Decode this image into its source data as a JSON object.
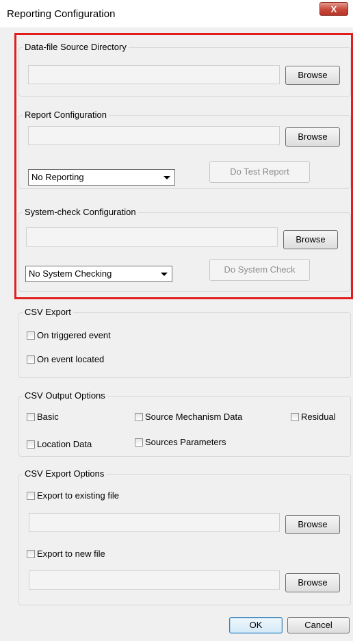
{
  "window": {
    "title": "Reporting Configuration",
    "close_glyph": "X"
  },
  "data_source": {
    "group_label": "Data-file Source Directory",
    "path": "",
    "browse_label": "Browse"
  },
  "report_config": {
    "group_label": "Report Configuration",
    "path": "",
    "browse_label": "Browse",
    "mode_value": "No Reporting",
    "test_label": "Do Test Report"
  },
  "system_check": {
    "group_label": "System-check Configuration",
    "path": "",
    "browse_label": "Browse",
    "mode_value": "No System Checking",
    "check_label": "Do System Check"
  },
  "csv_export": {
    "group_label": "CSV Export",
    "options": [
      {
        "label": "On triggered event",
        "checked": false
      },
      {
        "label": "On event located",
        "checked": false
      }
    ]
  },
  "csv_output": {
    "group_label": "CSV Output Options",
    "options": [
      {
        "label": "Basic",
        "checked": false
      },
      {
        "label": "Source Mechanism Data",
        "checked": false
      },
      {
        "label": "Residual",
        "checked": false
      },
      {
        "label": "Location Data",
        "checked": false
      },
      {
        "label": "Sources Parameters",
        "checked": false
      }
    ]
  },
  "csv_export_options": {
    "group_label": "CSV Export Options",
    "existing_label": "Export to existing file",
    "existing_path": "",
    "existing_browse": "Browse",
    "new_label": "Export to new file",
    "new_path": "",
    "new_browse": "Browse"
  },
  "footer": {
    "ok_label": "OK",
    "cancel_label": "Cancel"
  },
  "colors": {
    "highlight": "#e01e1e",
    "close_button": "#c7483a"
  }
}
